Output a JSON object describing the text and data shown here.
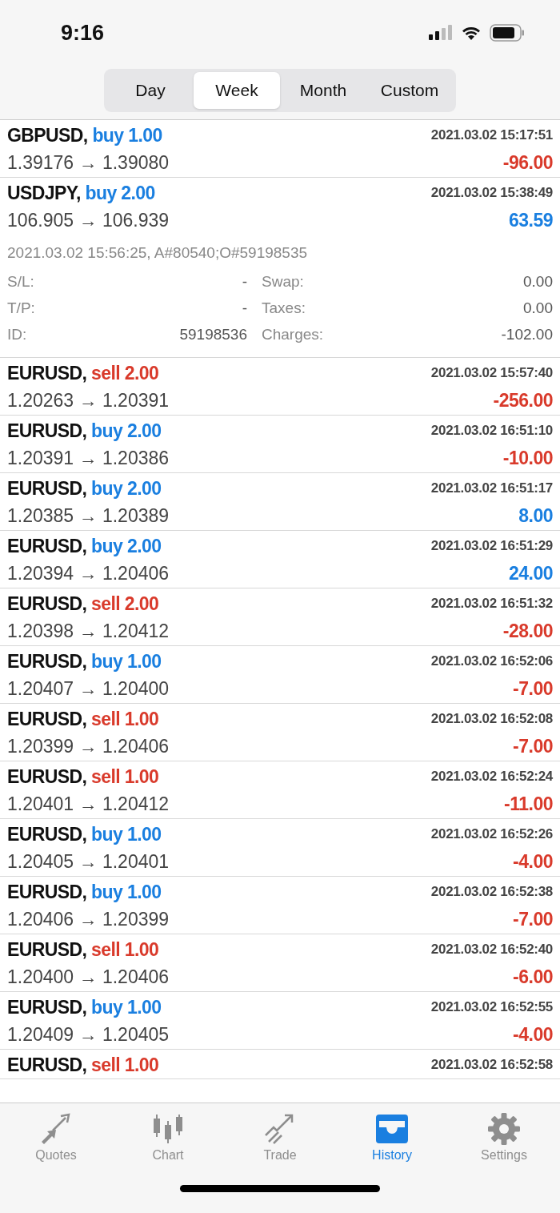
{
  "status_bar": {
    "time": "9:16"
  },
  "periods": [
    {
      "label": "Day",
      "selected": false
    },
    {
      "label": "Week",
      "selected": true
    },
    {
      "label": "Month",
      "selected": false
    },
    {
      "label": "Custom",
      "selected": false
    }
  ],
  "deals": [
    {
      "symbol": "GBPUSD,",
      "kind": "buy",
      "volume": "buy 1.00",
      "time": "2021.03.02 15:17:51",
      "prices": "1.39176 → 1.39080",
      "profit": "-96.00",
      "negative": true
    },
    {
      "symbol": "USDJPY,",
      "kind": "buy",
      "volume": "buy 2.00",
      "time": "2021.03.02 15:38:49",
      "prices": "106.905 → 106.939",
      "profit": "63.59",
      "negative": false,
      "expanded": true,
      "details": {
        "info": "2021.03.02 15:56:25, A#80540;O#59198535",
        "columns": [
          [
            {
              "label": "S/L:",
              "value": "-"
            },
            {
              "label": "T/P:",
              "value": "-"
            },
            {
              "label": "ID:",
              "value": "59198536"
            }
          ],
          [
            {
              "label": "Swap:",
              "value": "0.00"
            },
            {
              "label": "Taxes:",
              "value": "0.00"
            },
            {
              "label": "Charges:",
              "value": "-102.00"
            }
          ]
        ]
      }
    },
    {
      "symbol": "EURUSD,",
      "kind": "sell",
      "volume": "sell 2.00",
      "time": "2021.03.02 15:57:40",
      "prices": "1.20263 → 1.20391",
      "profit": "-256.00",
      "negative": true
    },
    {
      "symbol": "EURUSD,",
      "kind": "buy",
      "volume": "buy 2.00",
      "time": "2021.03.02 16:51:10",
      "prices": "1.20391 → 1.20386",
      "profit": "-10.00",
      "negative": true
    },
    {
      "symbol": "EURUSD,",
      "kind": "buy",
      "volume": "buy 2.00",
      "time": "2021.03.02 16:51:17",
      "prices": "1.20385 → 1.20389",
      "profit": "8.00",
      "negative": false
    },
    {
      "symbol": "EURUSD,",
      "kind": "buy",
      "volume": "buy 2.00",
      "time": "2021.03.02 16:51:29",
      "prices": "1.20394 → 1.20406",
      "profit": "24.00",
      "negative": false
    },
    {
      "symbol": "EURUSD,",
      "kind": "sell",
      "volume": "sell 2.00",
      "time": "2021.03.02 16:51:32",
      "prices": "1.20398 → 1.20412",
      "profit": "-28.00",
      "negative": true
    },
    {
      "symbol": "EURUSD,",
      "kind": "buy",
      "volume": "buy 1.00",
      "time": "2021.03.02 16:52:06",
      "prices": "1.20407 → 1.20400",
      "profit": "-7.00",
      "negative": true
    },
    {
      "symbol": "EURUSD,",
      "kind": "sell",
      "volume": "sell 1.00",
      "time": "2021.03.02 16:52:08",
      "prices": "1.20399 → 1.20406",
      "profit": "-7.00",
      "negative": true
    },
    {
      "symbol": "EURUSD,",
      "kind": "sell",
      "volume": "sell 1.00",
      "time": "2021.03.02 16:52:24",
      "prices": "1.20401 → 1.20412",
      "profit": "-11.00",
      "negative": true
    },
    {
      "symbol": "EURUSD,",
      "kind": "buy",
      "volume": "buy 1.00",
      "time": "2021.03.02 16:52:26",
      "prices": "1.20405 → 1.20401",
      "profit": "-4.00",
      "negative": true
    },
    {
      "symbol": "EURUSD,",
      "kind": "buy",
      "volume": "buy 1.00",
      "time": "2021.03.02 16:52:38",
      "prices": "1.20406 → 1.20399",
      "profit": "-7.00",
      "negative": true
    },
    {
      "symbol": "EURUSD,",
      "kind": "sell",
      "volume": "sell 1.00",
      "time": "2021.03.02 16:52:40",
      "prices": "1.20400 → 1.20406",
      "profit": "-6.00",
      "negative": true
    },
    {
      "symbol": "EURUSD,",
      "kind": "buy",
      "volume": "buy 1.00",
      "time": "2021.03.02 16:52:55",
      "prices": "1.20409 → 1.20405",
      "profit": "-4.00",
      "negative": true
    },
    {
      "symbol": "EURUSD,",
      "kind": "sell",
      "volume": "sell 1.00",
      "time": "2021.03.02 16:52:58"
    }
  ],
  "tab_bar": [
    {
      "label": "Quotes",
      "selected": false
    },
    {
      "label": "Chart",
      "selected": false
    },
    {
      "label": "Trade",
      "selected": false
    },
    {
      "label": "History",
      "selected": true
    },
    {
      "label": "Settings",
      "selected": false
    }
  ]
}
